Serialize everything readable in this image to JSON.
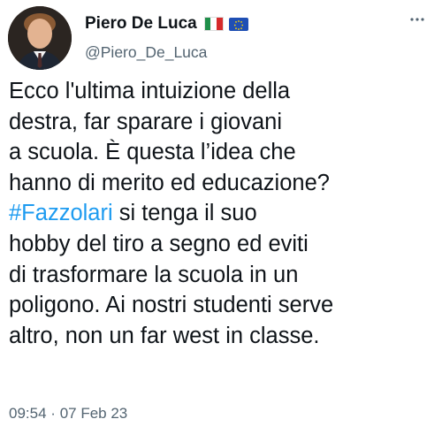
{
  "author": {
    "display_name": "Piero De Luca",
    "handle": "@Piero_De_Luca",
    "badges": [
      "italy-flag-icon",
      "eu-flag-icon"
    ]
  },
  "tweet": {
    "lines": [
      {
        "pre": "Ecco l'ultima intuizione della"
      },
      {
        "pre": "destra, far sparare i giovani"
      },
      {
        "pre": "a scuola. È questa l’idea che"
      },
      {
        "pre": "hanno di merito ed educazione?"
      },
      {
        "hashtag": "#Fazzolari",
        "post": " si tenga il suo"
      },
      {
        "pre": "hobby del tiro a segno ed eviti"
      },
      {
        "pre": "di trasformare la scuola in un"
      },
      {
        "pre": "poligono. Ai nostri studenti serve"
      },
      {
        "pre": "altro, non un far west in classe."
      }
    ],
    "hashtag_color": "#1d9bf0"
  },
  "meta": {
    "time": "09:54",
    "separator": "·",
    "date": "07 Feb 23"
  }
}
